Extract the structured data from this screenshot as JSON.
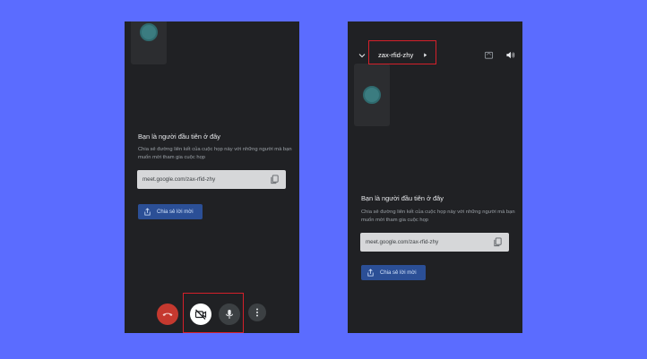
{
  "left_screen": {
    "empty_state": {
      "title": "Bạn là người đầu tiên ở đây",
      "description": "Chia sẻ đường liên kết của cuộc họp này với những người mà bạn muốn mời tham gia cuộc họp"
    },
    "link": {
      "url": "meet.google.com/zax-rfid-zhy"
    },
    "share_button": {
      "label": "Chia sẻ lời mời"
    },
    "controls": [
      {
        "name": "end-call",
        "icon": "phone-hangup-icon",
        "color": "#c5392f"
      },
      {
        "name": "camera-off",
        "icon": "camera-off-icon",
        "color": "#ffffff"
      },
      {
        "name": "microphone",
        "icon": "mic-icon",
        "color": "#3c4043"
      },
      {
        "name": "more-options",
        "icon": "more-vertical-icon",
        "color": "#3c4043"
      }
    ]
  },
  "right_screen": {
    "header": {
      "meeting_code": "zax-rfid-zhy"
    },
    "empty_state": {
      "title": "Bạn là người đầu tiên ở đây",
      "description": "Chia sẻ đường liên kết của cuộc họp này với những người mà bạn muốn mời tham gia cuộc họp"
    },
    "link": {
      "url": "meet.google.com/zax-rfid-zhy"
    },
    "share_button": {
      "label": "Chia sẻ lời mời"
    }
  },
  "colors": {
    "background": "#5b6cff",
    "phone_bg": "#202124",
    "highlight": "#d4202a",
    "share_button": "#2b4f96"
  }
}
